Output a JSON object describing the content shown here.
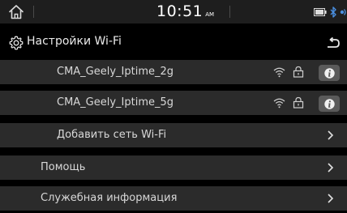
{
  "status_bar": {
    "time": "10:51",
    "ampm": "AM",
    "icons": [
      "home-icon",
      "battery-icon",
      "bluetooth-icon",
      "signal-icon"
    ]
  },
  "header": {
    "title": "Настройки Wi-Fi",
    "icons": [
      "gear-icon",
      "back-arrow-icon"
    ]
  },
  "networks": [
    {
      "name": "CMA_Geely_Iptime_2g",
      "icons": [
        "wifi-icon",
        "lock-icon",
        "info-icon"
      ]
    },
    {
      "name": "CMA_Geely_Iptime_5g",
      "icons": [
        "wifi-icon",
        "lock-icon",
        "info-icon"
      ]
    }
  ],
  "menu": {
    "add_network": "Добавить сеть Wi-Fi",
    "help": "Помощь",
    "service_info": "Служебная информация",
    "chevron_icon": "chevron-right-icon"
  },
  "colors": {
    "background": "#000000",
    "row": "#2b2b2b",
    "status_bar": "#1e1e1e",
    "info_button": "#5a5a5a"
  }
}
